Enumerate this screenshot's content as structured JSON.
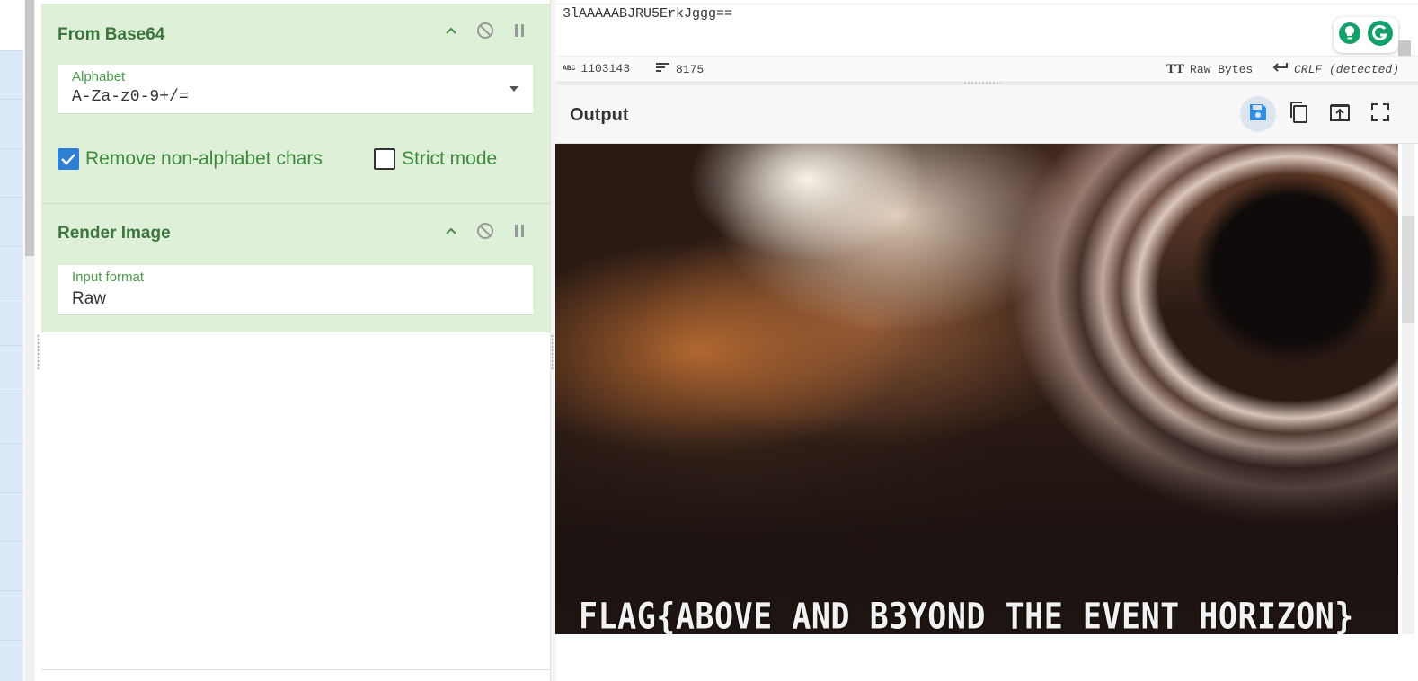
{
  "recipe": {
    "from_base64": {
      "title": "From Base64",
      "alphabet_label": "Alphabet",
      "alphabet_value": "A-Za-z0-9+/=",
      "remove_non_alphabet": {
        "label": "Remove non-alphabet chars",
        "checked": true
      },
      "strict_mode": {
        "label": "Strict mode",
        "checked": false
      }
    },
    "render_image": {
      "title": "Render Image",
      "input_format_label": "Input format",
      "input_format_value": "Raw"
    }
  },
  "input": {
    "text": "3lAAAAABJRU5ErkJggg=="
  },
  "status": {
    "length": "1103143",
    "lines": "8175",
    "encoding": "Raw Bytes",
    "eol": "CRLF (detected)"
  },
  "output": {
    "title": "Output",
    "flag_text": "FLAG{ABOVE AND B3YOND THE EVENT HORIZON}"
  },
  "icons": [
    "chevron-up-icon",
    "disable-icon",
    "pause-icon",
    "save-icon",
    "copy-icon",
    "replace-input-icon",
    "maximize-icon",
    "grammarly-icon",
    "lightbulb-icon",
    "abc-icon",
    "lines-icon",
    "text-format-icon",
    "return-icon",
    "checkbox-check-icon"
  ],
  "colors": {
    "op_background": "#dff0d8",
    "op_title": "#3c763d",
    "checkbox_on": "#2f7fd4",
    "save_icon": "#2f8fe6",
    "grammarly_green": "#15a06b"
  }
}
